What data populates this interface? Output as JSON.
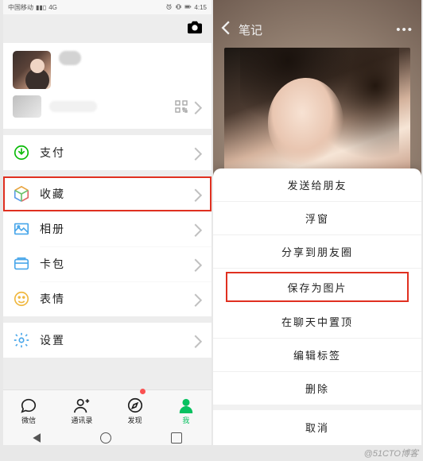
{
  "status": {
    "carrier": "中国移动",
    "signal": "4G",
    "time": "4:15"
  },
  "left": {
    "menu": {
      "pay": {
        "label": "支付"
      },
      "favorites": {
        "label": "收藏"
      },
      "album": {
        "label": "相册"
      },
      "cards": {
        "label": "卡包"
      },
      "stickers": {
        "label": "表情"
      },
      "settings": {
        "label": "设置"
      }
    },
    "tabs": {
      "chat": {
        "label": "微信"
      },
      "contacts": {
        "label": "通讯录"
      },
      "discover": {
        "label": "发现"
      },
      "me": {
        "label": "我"
      }
    }
  },
  "right": {
    "header": {
      "title": "笔记"
    },
    "actions": {
      "send_friend": "发送给朋友",
      "float": "浮窗",
      "share_moments": "分享到朋友圈",
      "save_image": "保存为图片",
      "pin_chat": "在聊天中置顶",
      "edit_tags": "编辑标签",
      "delete": "删除",
      "cancel": "取消"
    }
  },
  "watermark": "@51CTO博客",
  "colors": {
    "accent_green": "#07c160",
    "highlight_red": "#e03020"
  }
}
